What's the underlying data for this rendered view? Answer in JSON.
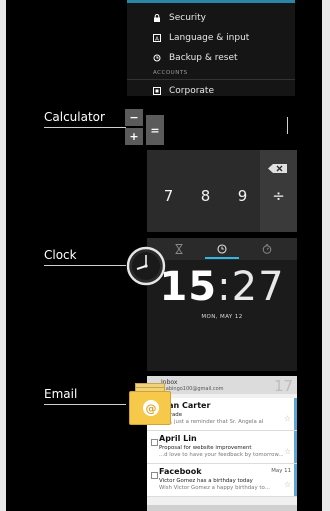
{
  "settings": {
    "items": [
      {
        "label": "Security",
        "icon": "lock-icon"
      },
      {
        "label": "Language & input",
        "icon": "keyboard-icon"
      },
      {
        "label": "Backup & reset",
        "icon": "backup-icon"
      }
    ],
    "section_header": "ACCOUNTS",
    "account_item": {
      "label": "Corporate",
      "icon": "corporate-icon"
    }
  },
  "apps": [
    {
      "name": "Calculator"
    },
    {
      "name": "Clock"
    },
    {
      "name": "Email"
    }
  ],
  "calculator": {
    "icon_keys": [
      "−",
      "+",
      "="
    ],
    "keys": [
      "7",
      "8",
      "9",
      "÷"
    ],
    "backspace_icon": "backspace-icon"
  },
  "clock": {
    "hour": "15",
    "separator": ":",
    "minute": "27",
    "date": "MON, MAY 12",
    "tabs": [
      "hourglass-icon",
      "clock-icon",
      "stopwatch-icon"
    ]
  },
  "email": {
    "inbox_label": "Inbox",
    "account": "...abingo100@gmail.com",
    "unread_count": "17",
    "messages": [
      {
        "from": "...an Carter",
        "subject": "Upgrade",
        "snippet": "...ay, just a reminder that Sr. Angela al",
        "date": "",
        "star": "☆"
      },
      {
        "from": "April Lin",
        "subject": "Proposal for website improvement",
        "snippet": "...d love to have your feedback by tomorrow...",
        "date": "",
        "star": "☆"
      },
      {
        "from": "Facebook",
        "subject": "Victor Gomez has a birthday today",
        "snippet": "Wish Victor Gomez a happy birthday to...",
        "date": "May 11",
        "star": "☆"
      }
    ]
  },
  "colors": {
    "accent": "#33b5e5",
    "background": "#000000",
    "email_icon": "#f7c94a"
  }
}
